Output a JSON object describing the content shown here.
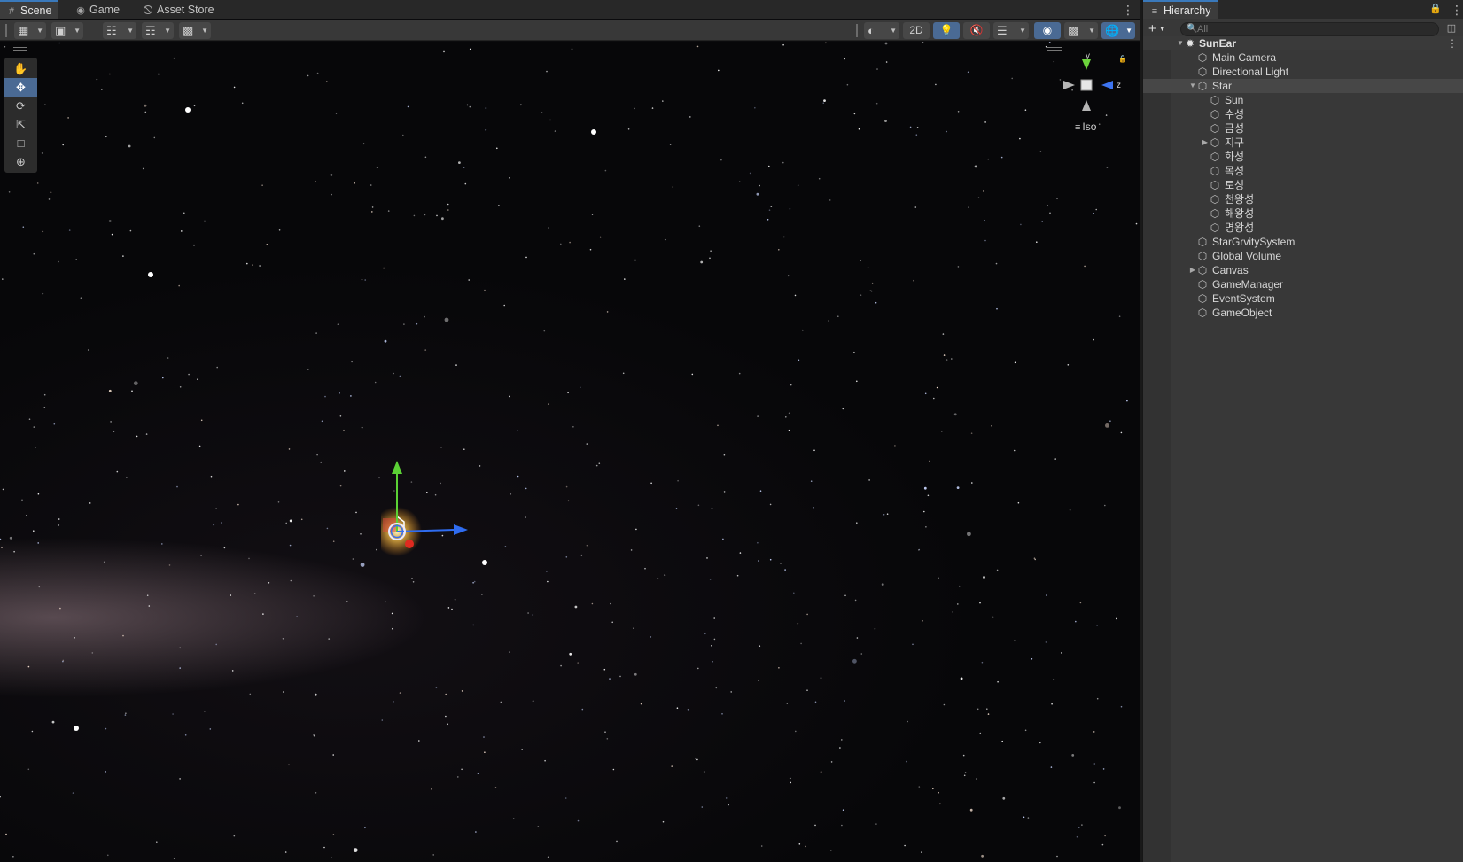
{
  "scene_panel": {
    "tabs": [
      {
        "label": "Scene",
        "icon": "grid-icon"
      },
      {
        "label": "Game",
        "icon": "gamepad-icon"
      },
      {
        "label": "Asset Store",
        "icon": "shopping-bag-icon"
      }
    ],
    "toolbar": {
      "view_2d_label": "2D"
    },
    "tools": [
      "hand-tool",
      "move-tool",
      "rotate-tool",
      "scale-tool",
      "rect-tool",
      "transform-tool"
    ],
    "active_tool": "move-tool",
    "orientation_gizmo": {
      "y_label": "y",
      "z_label": "z",
      "projection_label": "Iso"
    }
  },
  "hierarchy": {
    "title": "Hierarchy",
    "search": {
      "placeholder": "All"
    },
    "scene": {
      "name": "SunEar"
    },
    "items": [
      {
        "label": "Main Camera",
        "depth": 1,
        "expanded": null
      },
      {
        "label": "Directional Light",
        "depth": 1,
        "expanded": null
      },
      {
        "label": "Star",
        "depth": 1,
        "expanded": true,
        "highlighted": true
      },
      {
        "label": "Sun",
        "depth": 2,
        "expanded": null
      },
      {
        "label": "수성",
        "depth": 2,
        "expanded": null
      },
      {
        "label": "금성",
        "depth": 2,
        "expanded": null
      },
      {
        "label": "지구",
        "depth": 2,
        "expanded": false
      },
      {
        "label": "화성",
        "depth": 2,
        "expanded": null
      },
      {
        "label": "목성",
        "depth": 2,
        "expanded": null
      },
      {
        "label": "토성",
        "depth": 2,
        "expanded": null
      },
      {
        "label": "천왕성",
        "depth": 2,
        "expanded": null
      },
      {
        "label": "해왕성",
        "depth": 2,
        "expanded": null
      },
      {
        "label": "명왕성",
        "depth": 2,
        "expanded": null
      },
      {
        "label": "StarGrvitySystem",
        "depth": 1,
        "expanded": null
      },
      {
        "label": "Global Volume",
        "depth": 1,
        "expanded": null
      },
      {
        "label": "Canvas",
        "depth": 1,
        "expanded": false
      },
      {
        "label": "GameManager",
        "depth": 1,
        "expanded": null
      },
      {
        "label": "EventSystem",
        "depth": 1,
        "expanded": null
      },
      {
        "label": "GameObject",
        "depth": 1,
        "expanded": null
      }
    ]
  },
  "colors": {
    "accent": "#4a6a94",
    "tab_underline": "#3a79bb",
    "axis_x": "#d93a2b",
    "axis_y": "#5bd135",
    "axis_z": "#2f6cf0"
  }
}
